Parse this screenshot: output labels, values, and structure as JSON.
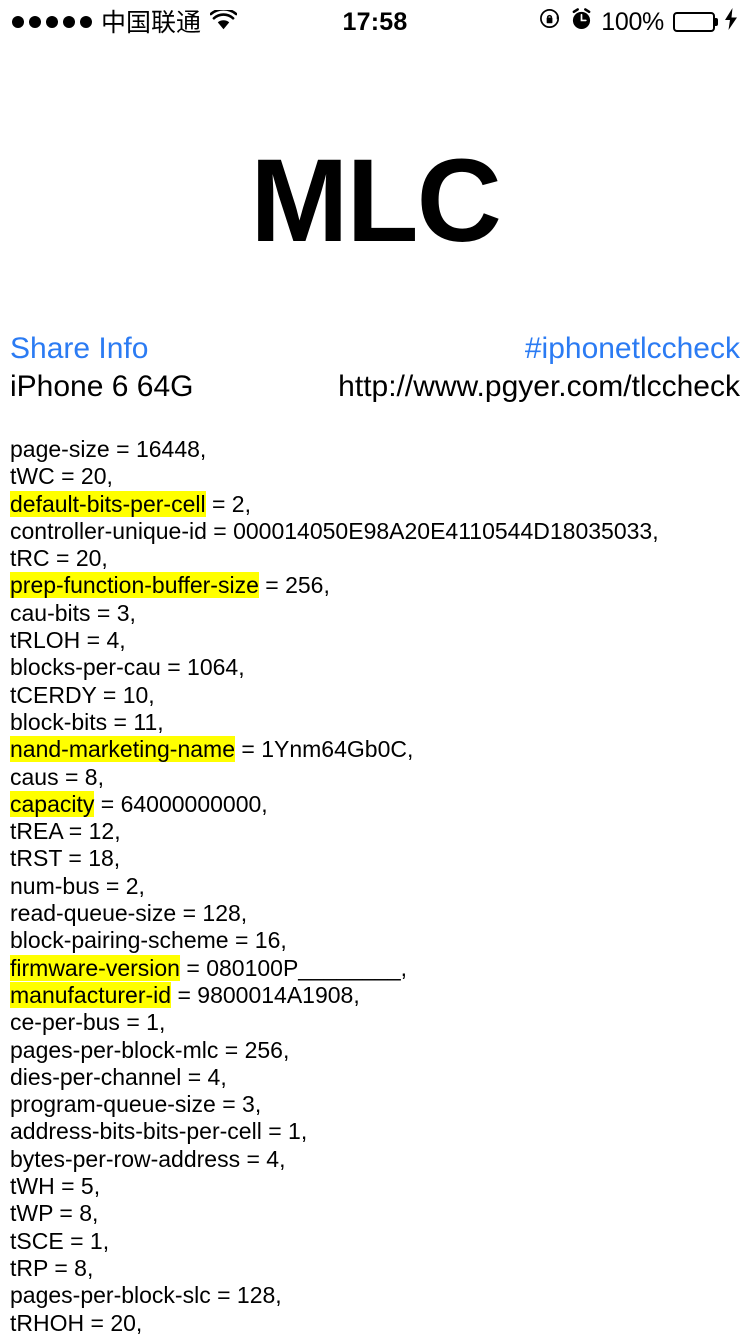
{
  "status_bar": {
    "signal_dots": 5,
    "carrier": "中国联通",
    "wifi_icon": "wifi-icon",
    "time": "17:58",
    "rotation_lock_icon": "rotation-lock-icon",
    "alarm_icon": "alarm-clock-icon",
    "battery_percent": "100%",
    "battery_level": 100,
    "battery_color": "#4cd964",
    "charging_icon": "lightning-bolt-icon"
  },
  "header": {
    "title": "MLC"
  },
  "info": {
    "share_label": "Share Info",
    "hashtag": "#iphonetlccheck",
    "device": "iPhone 6 64G",
    "url": "http://www.pgyer.com/tlccheck",
    "link_color": "#2b7bf3"
  },
  "properties": [
    {
      "key": "page-size",
      "value": "16448,",
      "highlight": false
    },
    {
      "key": "tWC",
      "value": "20,",
      "highlight": false
    },
    {
      "key": "default-bits-per-cell",
      "value": "2,",
      "highlight": true
    },
    {
      "key": "controller-unique-id",
      "value": "000014050E98A20E4110544D18035033,",
      "highlight": false
    },
    {
      "key": "tRC",
      "value": "20,",
      "highlight": false
    },
    {
      "key": "prep-function-buffer-size",
      "value": "256,",
      "highlight": true
    },
    {
      "key": "cau-bits",
      "value": "3,",
      "highlight": false
    },
    {
      "key": "tRLOH",
      "value": "4,",
      "highlight": false
    },
    {
      "key": "blocks-per-cau",
      "value": "1064,",
      "highlight": false
    },
    {
      "key": "tCERDY",
      "value": "10,",
      "highlight": false
    },
    {
      "key": "block-bits",
      "value": "11,",
      "highlight": false
    },
    {
      "key": "nand-marketing-name",
      "value": "1Ynm64Gb0C,",
      "highlight": true
    },
    {
      "key": "caus",
      "value": "8,",
      "highlight": false
    },
    {
      "key": "capacity",
      "value": "64000000000,",
      "highlight": true
    },
    {
      "key": "tREA",
      "value": "12,",
      "highlight": false
    },
    {
      "key": "tRST",
      "value": "18,",
      "highlight": false
    },
    {
      "key": "num-bus",
      "value": "2,",
      "highlight": false
    },
    {
      "key": "read-queue-size",
      "value": "128,",
      "highlight": false
    },
    {
      "key": "block-pairing-scheme",
      "value": "16,",
      "highlight": false
    },
    {
      "key": "firmware-version",
      "value": "080100P________,",
      "highlight": true
    },
    {
      "key": "manufacturer-id",
      "value": "9800014A1908,",
      "highlight": true
    },
    {
      "key": "ce-per-bus",
      "value": "1,",
      "highlight": false
    },
    {
      "key": "pages-per-block-mlc",
      "value": "256,",
      "highlight": false
    },
    {
      "key": "dies-per-channel",
      "value": "4,",
      "highlight": false
    },
    {
      "key": "program-queue-size",
      "value": "3,",
      "highlight": false
    },
    {
      "key": "address-bits-bits-per-cell",
      "value": "1,",
      "highlight": false
    },
    {
      "key": "bytes-per-row-address",
      "value": "4,",
      "highlight": false
    },
    {
      "key": "tWH",
      "value": "5,",
      "highlight": false
    },
    {
      "key": "tWP",
      "value": "8,",
      "highlight": false
    },
    {
      "key": "tSCE",
      "value": "1,",
      "highlight": false
    },
    {
      "key": "tRP",
      "value": "8,",
      "highlight": false
    },
    {
      "key": "pages-per-block-slc",
      "value": "128,",
      "highlight": false
    },
    {
      "key": "tRHOH",
      "value": "20,",
      "highlight": false
    }
  ]
}
